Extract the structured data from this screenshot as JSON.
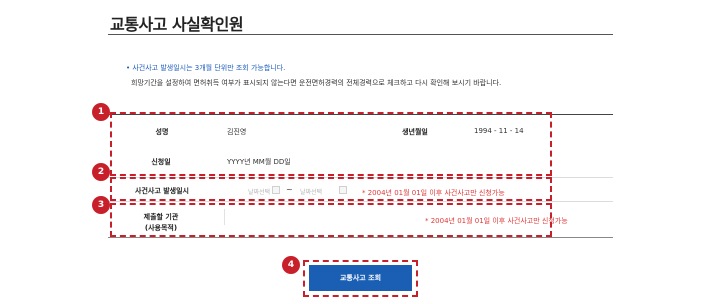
{
  "page": {
    "title": "교통사고 사실확인원"
  },
  "notices": {
    "period": "• 사건사고 발생일시는 3개월 단위만 조회 가능합니다.",
    "detail": "희망기간을 설정하여 면허취득 여부가 표시되지 않는다면 운전면허경력의 전체경력으로 체크하고 다시 확인해 보시기 바랍니다."
  },
  "form": {
    "name_label": "성명",
    "name_value": "김진영",
    "birth_label": "생년월일",
    "birth_value": "1994 - 11 - 14",
    "apply_label": "신청일",
    "apply_value": "YYYY년 MM월 DD일",
    "accident_label": "사건사고 발생일시",
    "date_start_placeholder": "날짜선택",
    "date_separator": "~",
    "date_end_placeholder": "날짜선택",
    "accident_hint": "* 2004년 01월 01일 이후 사건사고만 신청가능",
    "org_label_line1": "제출할 기관",
    "org_label_line2": "(사용목적)",
    "org_hint": "* 2004년 01월 01일 이후 사건사고만 신청가능"
  },
  "markers": [
    "1",
    "2",
    "3",
    "4"
  ],
  "buttons": {
    "submit": "교통사고 조회"
  },
  "colors": {
    "accent_red": "#c8202a",
    "button_blue": "#1a5fb4",
    "notice_blue": "#1f5fbf",
    "hint_red": "#e03a3a"
  }
}
